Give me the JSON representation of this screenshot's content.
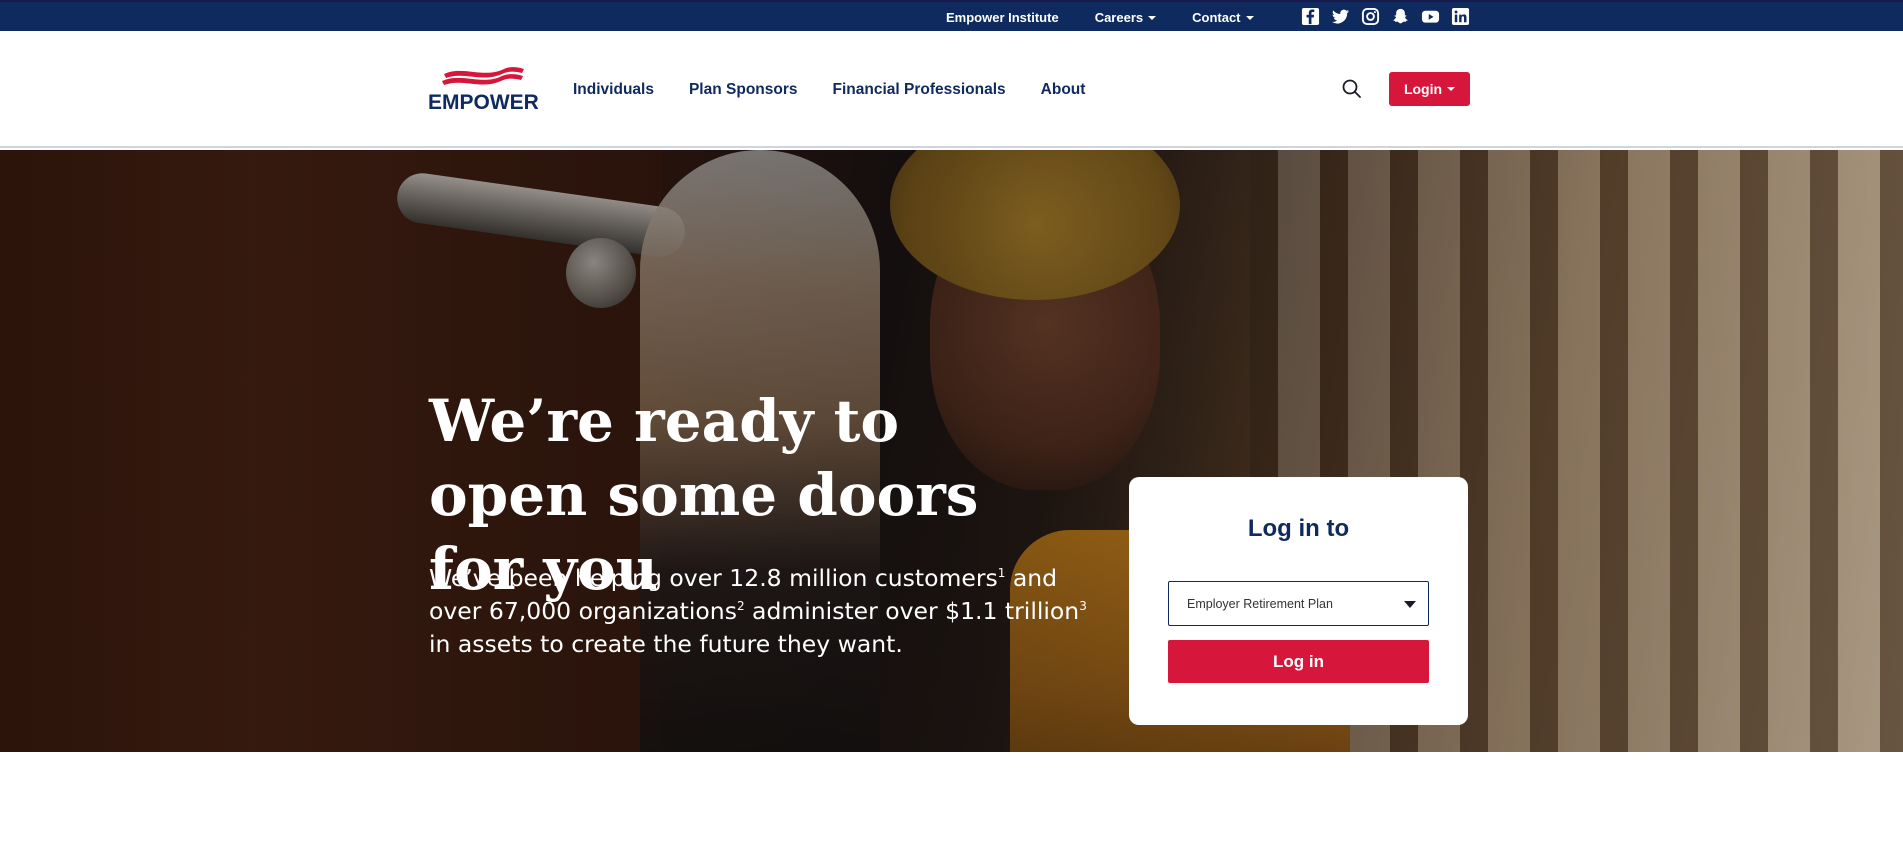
{
  "topbar": {
    "links": [
      {
        "label": "Empower Institute",
        "dropdown": false
      },
      {
        "label": "Careers",
        "dropdown": true
      },
      {
        "label": "Contact",
        "dropdown": true
      }
    ],
    "social_icons": [
      "facebook-icon",
      "twitter-icon",
      "instagram-icon",
      "snapchat-icon",
      "youtube-icon",
      "linkedin-icon"
    ]
  },
  "header": {
    "logo_text": "EMPOWER",
    "nav": [
      "Individuals",
      "Plan Sponsors",
      "Financial Professionals",
      "About"
    ],
    "login_label": "Login"
  },
  "hero": {
    "headline": "We’re ready to open some doors for you",
    "sub": {
      "part1": "We’ve been helping over 12.8 million customers",
      "sup1": "1",
      "part2": " and over 67,000 organizations",
      "sup2": "2",
      "part3": " administer over $1.1 trillion",
      "sup3": "3",
      "part4": " in assets to create the future they want."
    }
  },
  "login_card": {
    "title": "Log in to",
    "select_value": "Employer Retirement Plan",
    "button_label": "Log in"
  },
  "colors": {
    "navy": "#0f2a5e",
    "red": "#d6163a",
    "white": "#ffffff"
  }
}
